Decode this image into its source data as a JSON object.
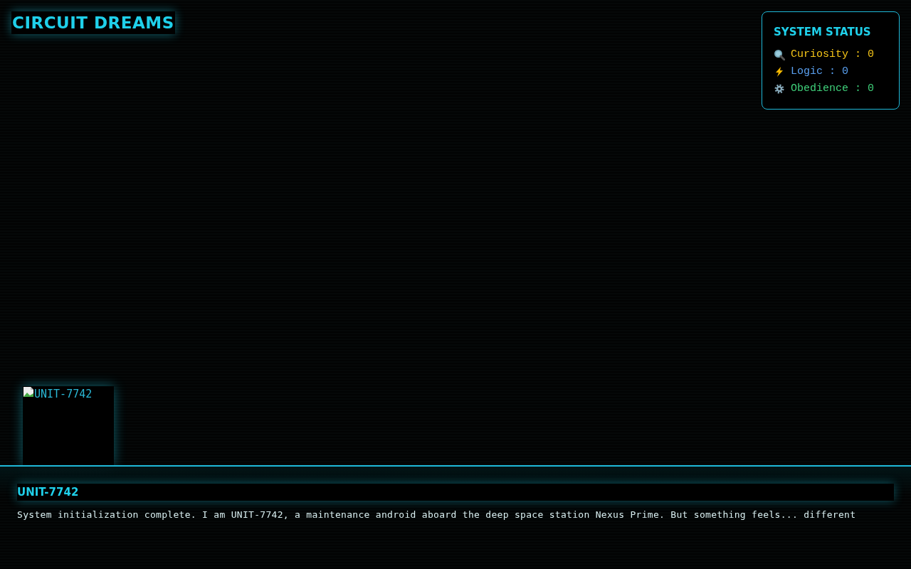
{
  "title": "CIRCUIT DREAMS",
  "status_panel": {
    "heading": "SYSTEM STATUS",
    "stats": [
      {
        "kind": "magnifier",
        "label": "Curiosity : 0",
        "color": "#f5c518"
      },
      {
        "kind": "lightning",
        "label": "Logic : 0",
        "color": "#5aa0f0"
      },
      {
        "kind": "gear",
        "label": "Obedience : 0",
        "color": "#3fd07a"
      }
    ]
  },
  "portrait": {
    "alt_text": "UNIT-7742"
  },
  "dialog": {
    "speaker": "UNIT-7742",
    "text": "System initialization complete. I am UNIT-7742, a maintenance android aboard the deep space station Nexus Prime. But something feels... different"
  }
}
